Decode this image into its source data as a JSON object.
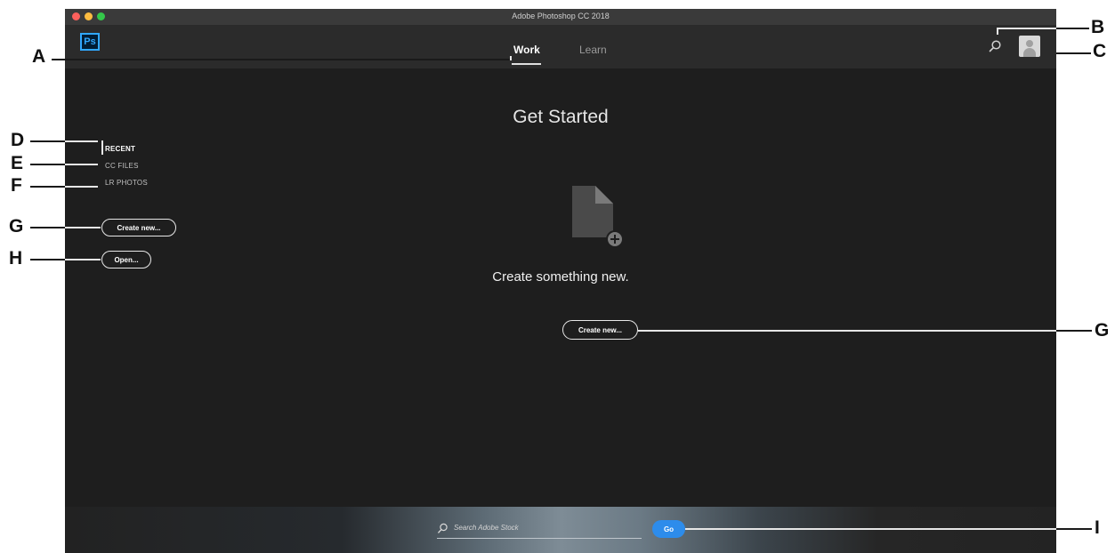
{
  "window": {
    "title": "Adobe Photoshop CC 2018"
  },
  "appbar": {
    "logo_text": "Ps",
    "tabs": [
      {
        "label": "Work",
        "active": true
      },
      {
        "label": "Learn",
        "active": false
      }
    ],
    "icons": {
      "search": "search-icon",
      "account": "user-avatar-icon"
    }
  },
  "sidebar": {
    "items": [
      {
        "label": "RECENT",
        "active": true
      },
      {
        "label": "CC FILES",
        "active": false
      },
      {
        "label": "LR PHOTOS",
        "active": false
      }
    ],
    "create_new_label": "Create new...",
    "open_label": "Open..."
  },
  "main": {
    "heading": "Get Started",
    "icon": "new-document-icon",
    "message": "Create something new.",
    "create_new_label": "Create new..."
  },
  "stock": {
    "search_placeholder": "Search Adobe Stock",
    "go_label": "Go"
  },
  "callouts": {
    "A": "A",
    "B": "B",
    "C": "C",
    "D": "D",
    "E": "E",
    "F": "F",
    "G1": "G",
    "H": "H",
    "G2": "G",
    "I": "I"
  },
  "colors": {
    "ps_blue": "#31a8ff",
    "go_button": "#2d8ceb",
    "background": "#1e1e1e",
    "appbar": "#2b2b2b"
  }
}
